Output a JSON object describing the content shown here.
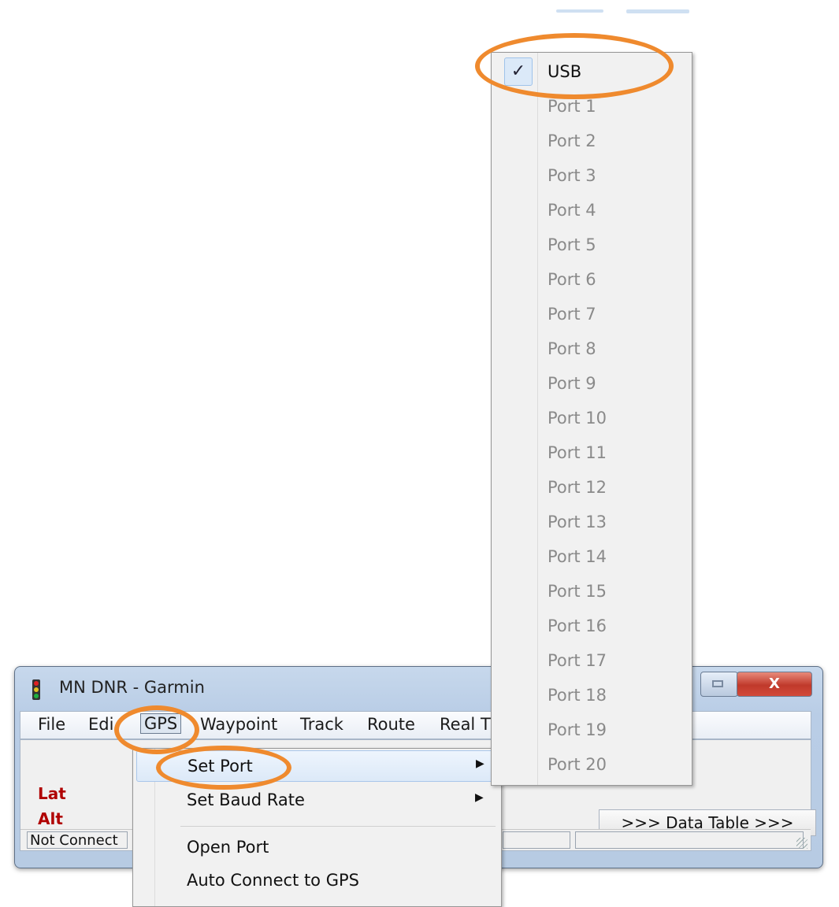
{
  "window": {
    "title": "MN DNR - Garmin",
    "close_glyph": "X"
  },
  "menubar": {
    "items": [
      "File",
      "Edi",
      "GPS",
      "Waypoint",
      "Track",
      "Route",
      "Real Ti"
    ]
  },
  "client": {
    "lat_label": "Lat",
    "alt_label": "Alt",
    "data_table_button": ">>> Data Table >>>",
    "status": "Not Connect"
  },
  "gps_menu": {
    "items": [
      {
        "label": "Set  Port",
        "submenu": true,
        "highlighted": true
      },
      {
        "label": "Set Baud Rate",
        "submenu": true
      },
      {
        "label": "Open Port"
      },
      {
        "label": "Auto Connect to GPS"
      }
    ]
  },
  "port_menu": {
    "check_glyph": "✓",
    "items": [
      "USB",
      "Port 1",
      "Port 2",
      "Port 3",
      "Port 4",
      "Port 5",
      "Port 6",
      "Port 7",
      "Port 8",
      "Port 9",
      "Port 10",
      "Port 11",
      "Port 12",
      "Port 13",
      "Port 14",
      "Port 15",
      "Port 16",
      "Port 17",
      "Port 18",
      "Port 19",
      "Port 20"
    ],
    "selected": "USB"
  },
  "annotation_color": "#ef8a2e"
}
